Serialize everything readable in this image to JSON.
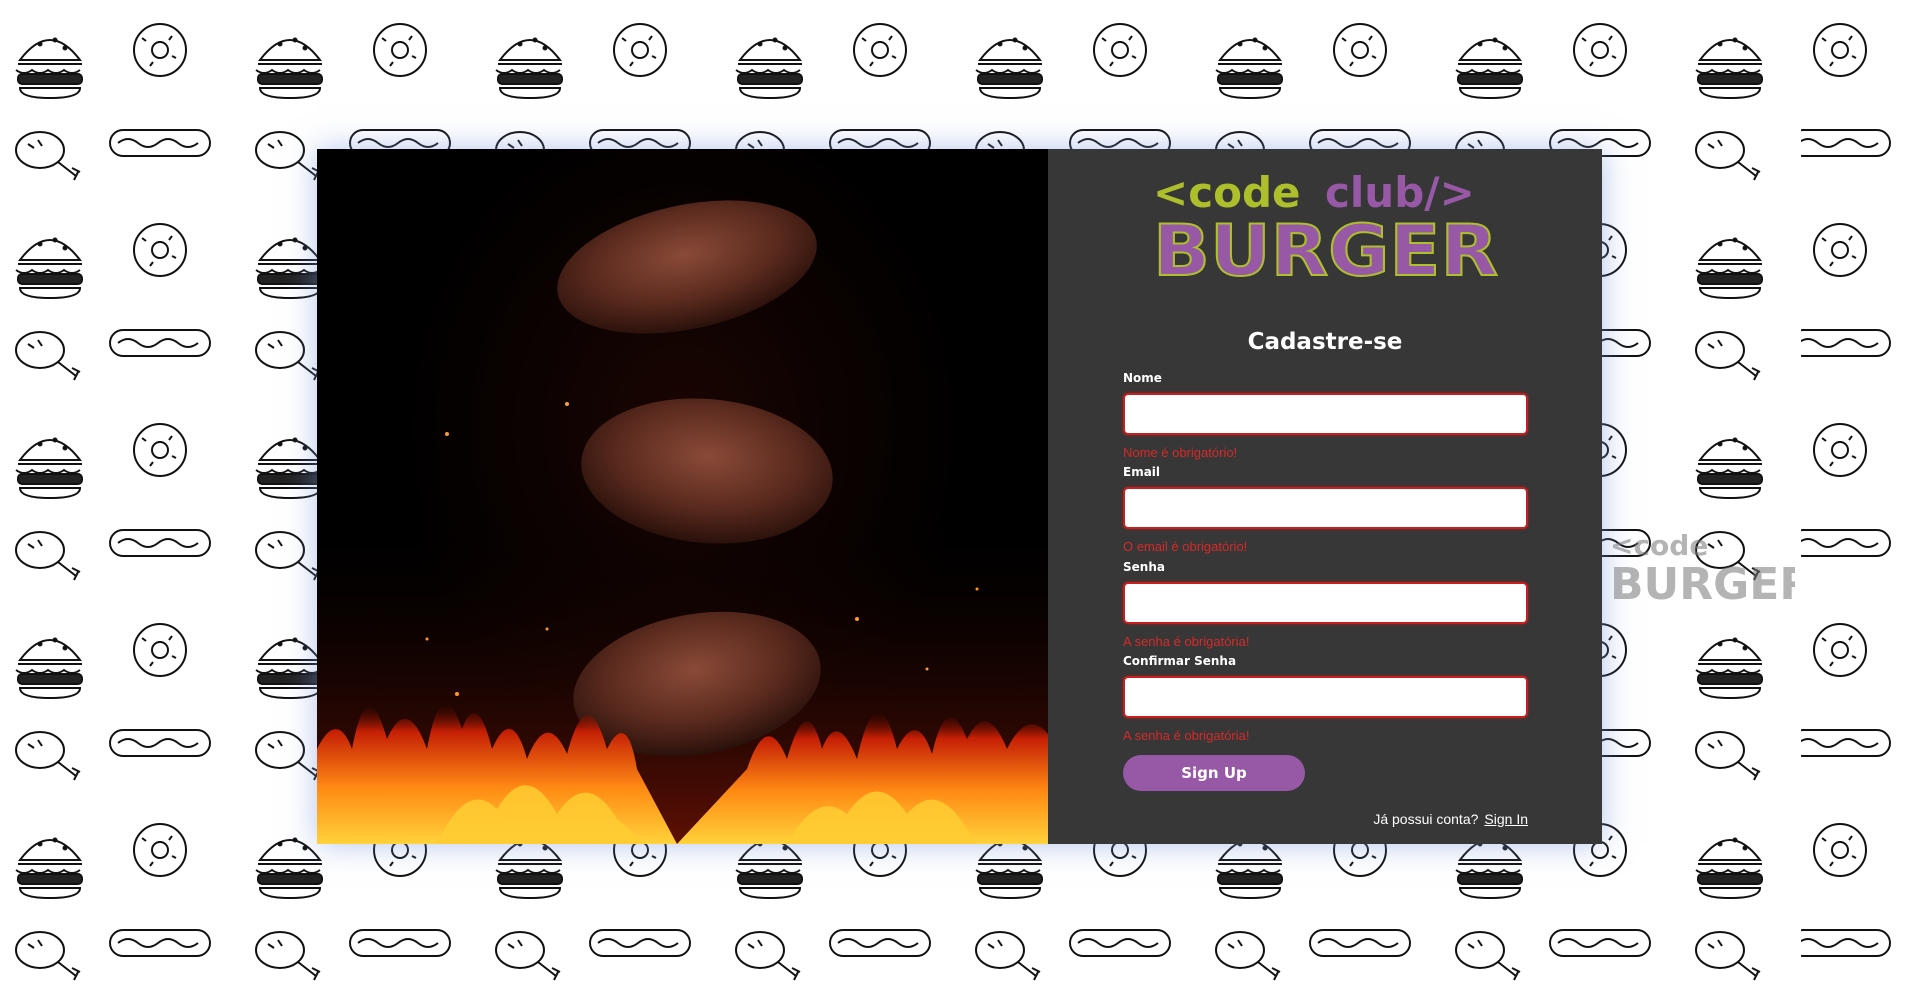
{
  "logo": {
    "line1_open": "<code",
    "line1_club": "club/>",
    "line2": "BURGER"
  },
  "form": {
    "title": "Cadastre-se",
    "fields": [
      {
        "label": "Nome",
        "value": "",
        "placeholder": "",
        "error": "Nome é obrigatório!"
      },
      {
        "label": "Email",
        "value": "",
        "placeholder": "",
        "error": "O email é obrigatório!"
      },
      {
        "label": "Senha",
        "value": "",
        "placeholder": "",
        "error": "A senha é obrigatória!"
      },
      {
        "label": "Confirmar Senha",
        "value": "",
        "placeholder": "",
        "error": "A senha é obrigatória!"
      }
    ],
    "submit_label": "Sign Up",
    "has_account_text": "Já possui conta?",
    "signin_link": "Sign In"
  },
  "colors": {
    "accent_green": "#aebf2c",
    "accent_purple": "#9758a6",
    "error_red": "#d42a2a",
    "panel_bg": "#373737"
  },
  "icons": [
    "burger-doodle-pattern",
    "food-illustration"
  ]
}
